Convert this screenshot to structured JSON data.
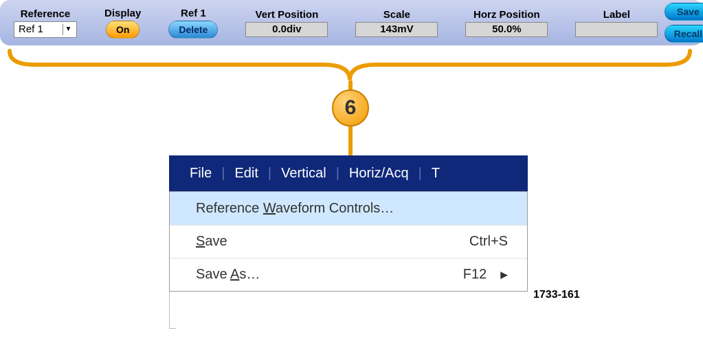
{
  "toolbar": {
    "reference": {
      "label": "Reference",
      "value": "Ref 1"
    },
    "display": {
      "label": "Display",
      "button": "On"
    },
    "ref1": {
      "label": "Ref 1",
      "button": "Delete"
    },
    "vert": {
      "label": "Vert Position",
      "value": "0.0div"
    },
    "scale": {
      "label": "Scale",
      "value": "143mV"
    },
    "horz": {
      "label": "Horz Position",
      "value": "50.0%"
    },
    "labelField": {
      "label": "Label",
      "value": ""
    },
    "save": "Save",
    "recall": "Recall"
  },
  "callout": "6",
  "menubar": {
    "items": [
      "File",
      "Edit",
      "Vertical",
      "Horiz/Acq",
      "T"
    ]
  },
  "dropdown": {
    "row0": {
      "pre": "Reference ",
      "u": "W",
      "post": "aveform Controls…"
    },
    "row1": {
      "u": "S",
      "post": "ave",
      "shortcut": "Ctrl+S"
    },
    "row2": {
      "pre": "Save ",
      "u": "A",
      "post": "s…",
      "shortcut": "F12",
      "submenu": true
    }
  },
  "figureId": "1733-161"
}
